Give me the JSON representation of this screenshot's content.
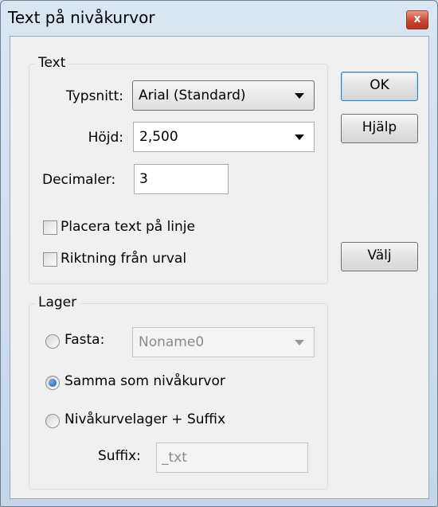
{
  "window": {
    "title": "Text på nivåkurvor",
    "close_symbol": "x"
  },
  "text_group": {
    "legend": "Text",
    "font_label": "Typsnitt:",
    "font_value": "Arial (Standard)",
    "height_label": "Höjd:",
    "height_value": "2,500",
    "decimals_label": "Decimaler:",
    "decimals_value": "3",
    "place_on_line_label": "Placera text på linje",
    "place_on_line_checked": false,
    "direction_from_selection_label": "Riktning från urval",
    "direction_from_selection_checked": false
  },
  "layer_group": {
    "legend": "Lager",
    "fixed_label": "Fasta:",
    "fixed_value": "Noname0",
    "same_as_contours_label": "Samma som nivåkurvor",
    "contour_layer_suffix_label": "Nivåkurvelager + Suffix",
    "suffix_label": "Suffix:",
    "suffix_value": "_txt",
    "selected_option": "same_as_contours"
  },
  "buttons": {
    "ok": "OK",
    "help": "Hjälp",
    "select": "Välj"
  }
}
